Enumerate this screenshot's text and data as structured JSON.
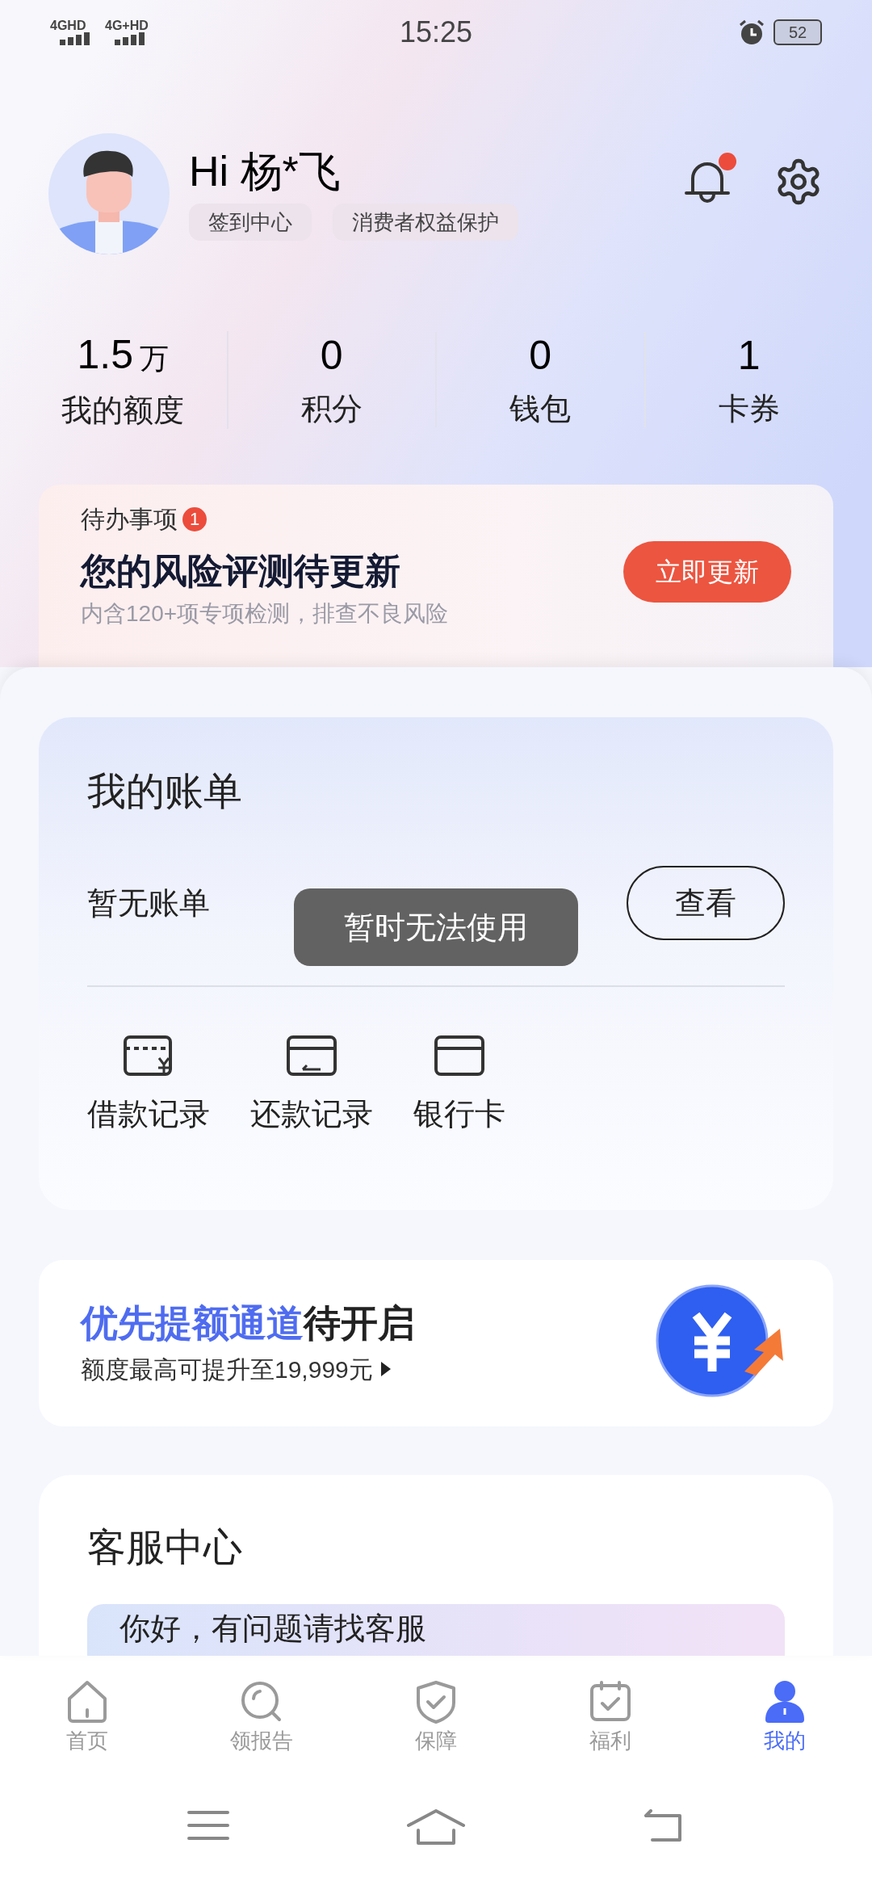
{
  "status_bar": {
    "networks": [
      "4GHD",
      "4G+HD"
    ],
    "time": "15:25",
    "battery": "52"
  },
  "profile": {
    "greeting": "Hi 杨*飞",
    "chips": [
      "签到中心",
      "消费者权益保护"
    ],
    "notification_dot": true
  },
  "stats": [
    {
      "value": "1.5",
      "unit": "万",
      "label": "我的额度"
    },
    {
      "value": "0",
      "label": "积分"
    },
    {
      "value": "0",
      "label": "钱包"
    },
    {
      "value": "1",
      "label": "卡券"
    }
  ],
  "todo": {
    "label": "待办事项",
    "count": "1",
    "title": "您的风险评测待更新",
    "subtitle": "内含120+项专项检测，排查不良风险",
    "button": "立即更新"
  },
  "bill": {
    "title": "我的账单",
    "status": "暂无账单",
    "toast": "暂时无法使用",
    "button": "查看",
    "actions": [
      {
        "label": "借款记录",
        "kind": "loan"
      },
      {
        "label": "还款记录",
        "kind": "repay"
      },
      {
        "label": "银行卡",
        "kind": "card"
      }
    ]
  },
  "promo": {
    "title_highlight": "优先提额通道",
    "title_rest": "待开启",
    "subtitle": "额度最高可提升至19,999元"
  },
  "service": {
    "title": "客服中心",
    "banner": "你好，有问题请找客服"
  },
  "nav": [
    {
      "label": "首页",
      "kind": "home",
      "selected": false
    },
    {
      "label": "领报告",
      "kind": "report",
      "selected": false
    },
    {
      "label": "保障",
      "kind": "shield",
      "selected": false
    },
    {
      "label": "福利",
      "kind": "calendar",
      "selected": false
    },
    {
      "label": "我的",
      "kind": "person",
      "selected": true
    }
  ]
}
